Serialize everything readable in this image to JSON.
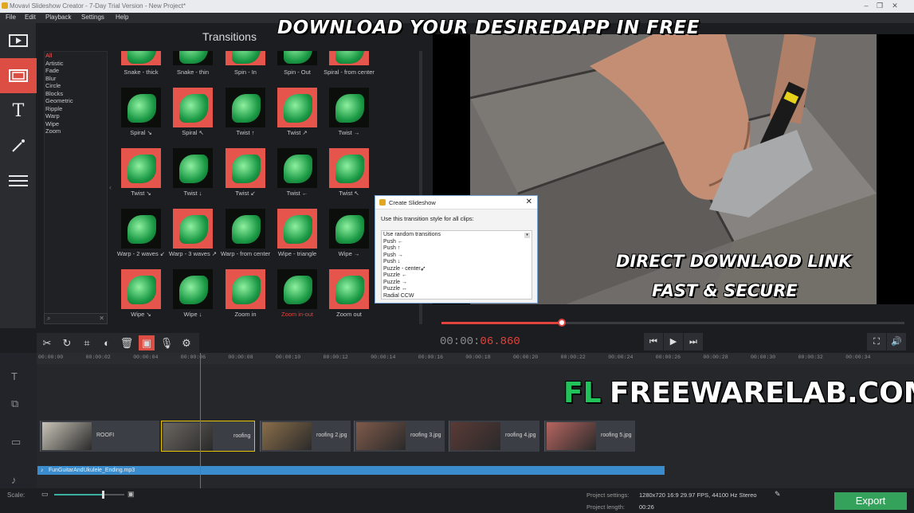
{
  "window": {
    "title": "Movavi Slideshow Creator - 7-Day Trial Version - New Project*"
  },
  "menu": [
    "File",
    "Edit",
    "Playback",
    "Settings",
    "Help"
  ],
  "sidebar": [
    {
      "icon": "film-icon"
    },
    {
      "icon": "transitions-icon"
    },
    {
      "icon": "text-icon"
    },
    {
      "icon": "magic-wand-icon"
    },
    {
      "icon": "menu-icon"
    }
  ],
  "transitions": {
    "title": "Transitions",
    "categories": [
      "All",
      "Artistic",
      "Fade",
      "Blur",
      "Circle",
      "Blocks",
      "Geometric",
      "Ripple",
      "Warp",
      "Wipe",
      "Zoom"
    ],
    "selected_category": "All",
    "rows": [
      [
        "Snake - thick",
        "Snake - thin",
        "Spin - In",
        "Spin - Out",
        "Spiral - from center"
      ],
      [
        "Spiral ↘",
        "Spiral ↖",
        "Twist ↑",
        "Twist ↗",
        "Twist →"
      ],
      [
        "Twist ↘",
        "Twist ↓",
        "Twist ↙",
        "Twist ←",
        "Twist ↖"
      ],
      [
        "Warp - 2 waves ↙",
        "Warp - 3 waves ↗",
        "Warp - from center",
        "Wipe - triangle",
        "Wipe →"
      ],
      [
        "Wipe ↘",
        "Wipe ↓",
        "Zoom in",
        "Zoom in-out",
        "Zoom out"
      ]
    ],
    "highlighted": "Zoom in-out"
  },
  "dialog": {
    "title": "Create Slideshow",
    "prompt": "Use this transition style for all clips:",
    "options": [
      "Use random transitions",
      "Push ←",
      "Push ↑",
      "Push →",
      "Push ↓",
      "Puzzle - center",
      "Puzzle ←",
      "Puzzle →",
      "Puzzle ↔",
      "Radial CCW"
    ]
  },
  "player": {
    "timecode_dim": "00:00:",
    "timecode_hl": "06.860",
    "progress": 0.26
  },
  "watermarks": {
    "top": "DOWNLOAD YOUR DESIREDAPP IN FREE",
    "mid1": "DIRECT DOWNLAOD LINK",
    "mid2": "FAST & SECURE",
    "brand_fl": "FL",
    "brand_site": "FREEWARELAB.COM"
  },
  "timeline": {
    "ticks": [
      "00:00:00",
      "00:00:02",
      "00:00:04",
      "00:00:06",
      "00:00:08",
      "00:00:10",
      "00:00:12",
      "00:00:14",
      "00:00:16",
      "00:00:18",
      "00:00:20",
      "00:00:22",
      "00:00:24",
      "00:00:26",
      "00:00:28",
      "00:00:30",
      "00:00:32",
      "00:00:34"
    ],
    "clips": [
      "ROOFI",
      "roofing",
      "roofing 2.jpg",
      "roofing 3.jpg",
      "roofing 4.jpg",
      "roofing 5.jpg"
    ],
    "audio": "FunGuitarAndUkulele_Ending.mp3"
  },
  "footer": {
    "scale_label": "Scale:",
    "settings_label": "Project settings:",
    "settings_value": "1280x720 16:9 29.97 FPS, 44100 Hz Stereo",
    "length_label": "Project length:",
    "length_value": "00:26",
    "export_label": "Export"
  },
  "colors": {
    "accent": "#dc4e44",
    "export": "#35a25b",
    "audio": "#3b8ccc"
  }
}
